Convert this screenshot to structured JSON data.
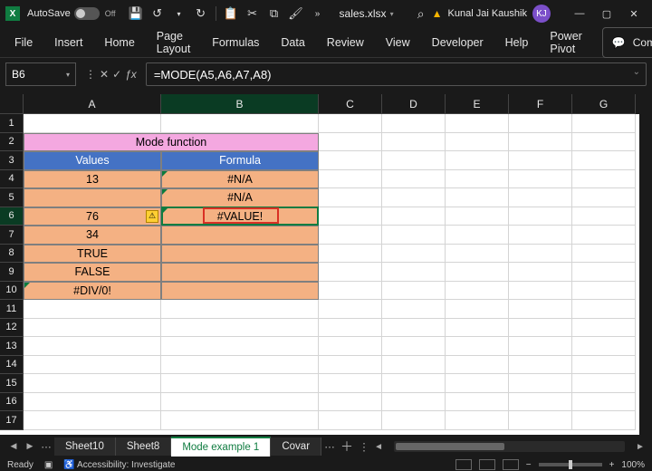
{
  "titlebar": {
    "autosave_label": "AutoSave",
    "autosave_state": "Off",
    "filename": "sales.xlsx",
    "search_icon": "⌕",
    "premium_icon": "▲",
    "user_name": "Kunal Jai Kaushik",
    "user_initials": "KJ"
  },
  "ribbon": {
    "tabs": [
      "File",
      "Insert",
      "Home",
      "Page Layout",
      "Formulas",
      "Data",
      "Review",
      "View",
      "Developer",
      "Help",
      "Power Pivot"
    ],
    "comments": "Comments"
  },
  "formula_bar": {
    "cell_ref": "B6",
    "formula": "=MODE(A5,A6,A7,A8)"
  },
  "grid": {
    "columns": [
      "A",
      "B",
      "C",
      "D",
      "E",
      "F",
      "G"
    ],
    "rows": [
      "1",
      "2",
      "3",
      "4",
      "5",
      "6",
      "7",
      "8",
      "9",
      "10",
      "11",
      "12",
      "13",
      "14",
      "15",
      "16",
      "17"
    ],
    "merged_title": "Mode function",
    "headers": {
      "A": "Values",
      "B": "Formula"
    },
    "data": {
      "A4": "13",
      "B4": "#N/A",
      "A5": "",
      "B5": "#N/A",
      "A6": "76",
      "B6": "#VALUE!",
      "A7": "34",
      "A8": "TRUE",
      "A9": "FALSE",
      "A10": "#DIV/0!"
    },
    "active_cell": "B6",
    "highlighted_error": "B6"
  },
  "sheets": {
    "tabs": [
      "Sheet10",
      "Sheet8",
      "Mode example 1",
      "Covar"
    ],
    "active": "Mode example 1"
  },
  "statusbar": {
    "state": "Ready",
    "accessibility": "Accessibility: Investigate",
    "zoom": "100%"
  }
}
